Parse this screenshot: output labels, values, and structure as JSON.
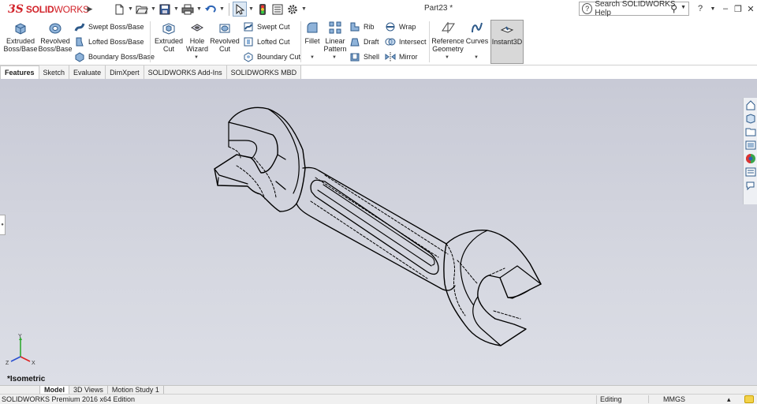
{
  "app": {
    "logo_mark": "3S",
    "logo_solid": "SOLID",
    "logo_works": "WORKS",
    "document_title": "Part23 *",
    "search_placeholder": "Search SOLIDWORKS Help",
    "help_icon": "?"
  },
  "ribbon": {
    "extruded_boss": "Extruded Boss/Base",
    "revolved_boss": "Revolved Boss/Base",
    "swept_boss": "Swept Boss/Base",
    "lofted_boss": "Lofted Boss/Base",
    "boundary_boss": "Boundary Boss/Base",
    "extruded_cut": "Extruded Cut",
    "hole_wizard": "Hole Wizard",
    "revolved_cut": "Revolved Cut",
    "swept_cut": "Swept Cut",
    "lofted_cut": "Lofted Cut",
    "boundary_cut": "Boundary Cut",
    "fillet": "Fillet",
    "linear_pattern": "Linear Pattern",
    "rib": "Rib",
    "draft": "Draft",
    "shell": "Shell",
    "wrap": "Wrap",
    "intersect": "Intersect",
    "mirror": "Mirror",
    "reference_geometry": "Reference Geometry",
    "curves": "Curves",
    "instant3d": "Instant3D"
  },
  "command_tabs": [
    "Features",
    "Sketch",
    "Evaluate",
    "DimXpert",
    "SOLIDWORKS Add-Ins",
    "SOLIDWORKS MBD"
  ],
  "viewport": {
    "view_name": "*Isometric",
    "triad": {
      "x": "X",
      "y": "Y",
      "z": "Z"
    }
  },
  "bottom_tabs": [
    "Model",
    "3D Views",
    "Motion Study 1"
  ],
  "status": {
    "product": "SOLIDWORKS Premium 2016 x64 Edition",
    "mode": "Editing Part",
    "units": "MMGS",
    "more": "▴"
  },
  "colors": {
    "brand_red": "#d2232a",
    "viewport_top": "#c8cad6",
    "viewport_bottom": "#dcdee6",
    "edge": "#000000"
  }
}
